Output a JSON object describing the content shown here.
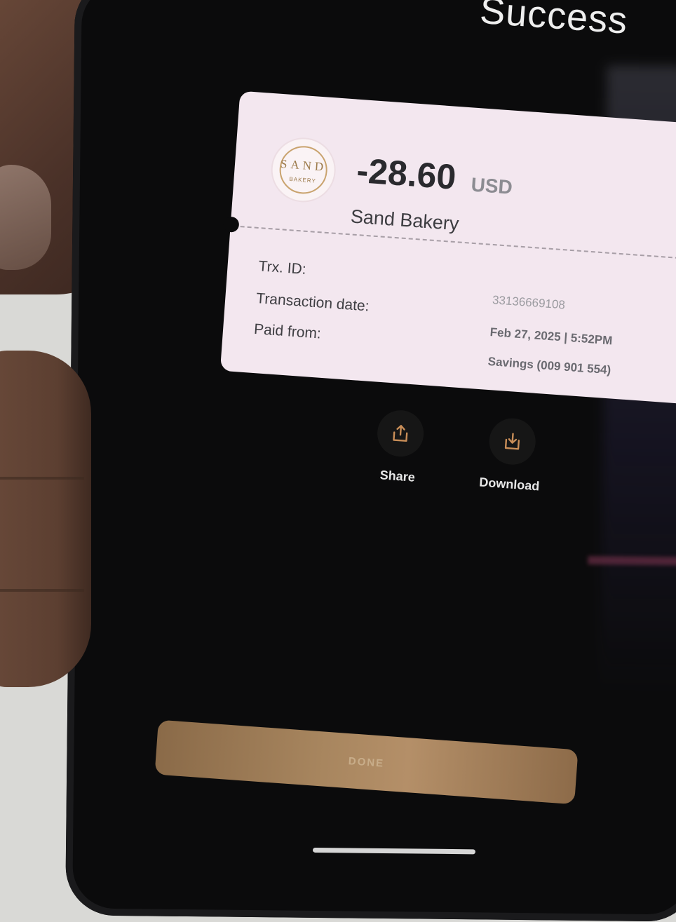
{
  "header": {
    "title": "Success"
  },
  "receipt": {
    "merchant_logo": {
      "name": "SAND",
      "sub": "BAKERY"
    },
    "amount": "-28.60",
    "currency": "USD",
    "merchant": "Sand Bakery",
    "rows": [
      {
        "label": "Trx. ID:",
        "value": "33136669108"
      },
      {
        "label": "Transaction date:",
        "value": "Feb 27, 2025 | 5:52PM"
      },
      {
        "label": "Paid from:",
        "value": "Savings (009 901 554)"
      }
    ]
  },
  "actions": {
    "share_label": "Share",
    "download_label": "Download"
  },
  "footer": {
    "done_label": "DONE"
  },
  "colors": {
    "accent": "#a8865f",
    "card_background": "#f3e7ef",
    "screen_background": "#0b0b0c"
  }
}
